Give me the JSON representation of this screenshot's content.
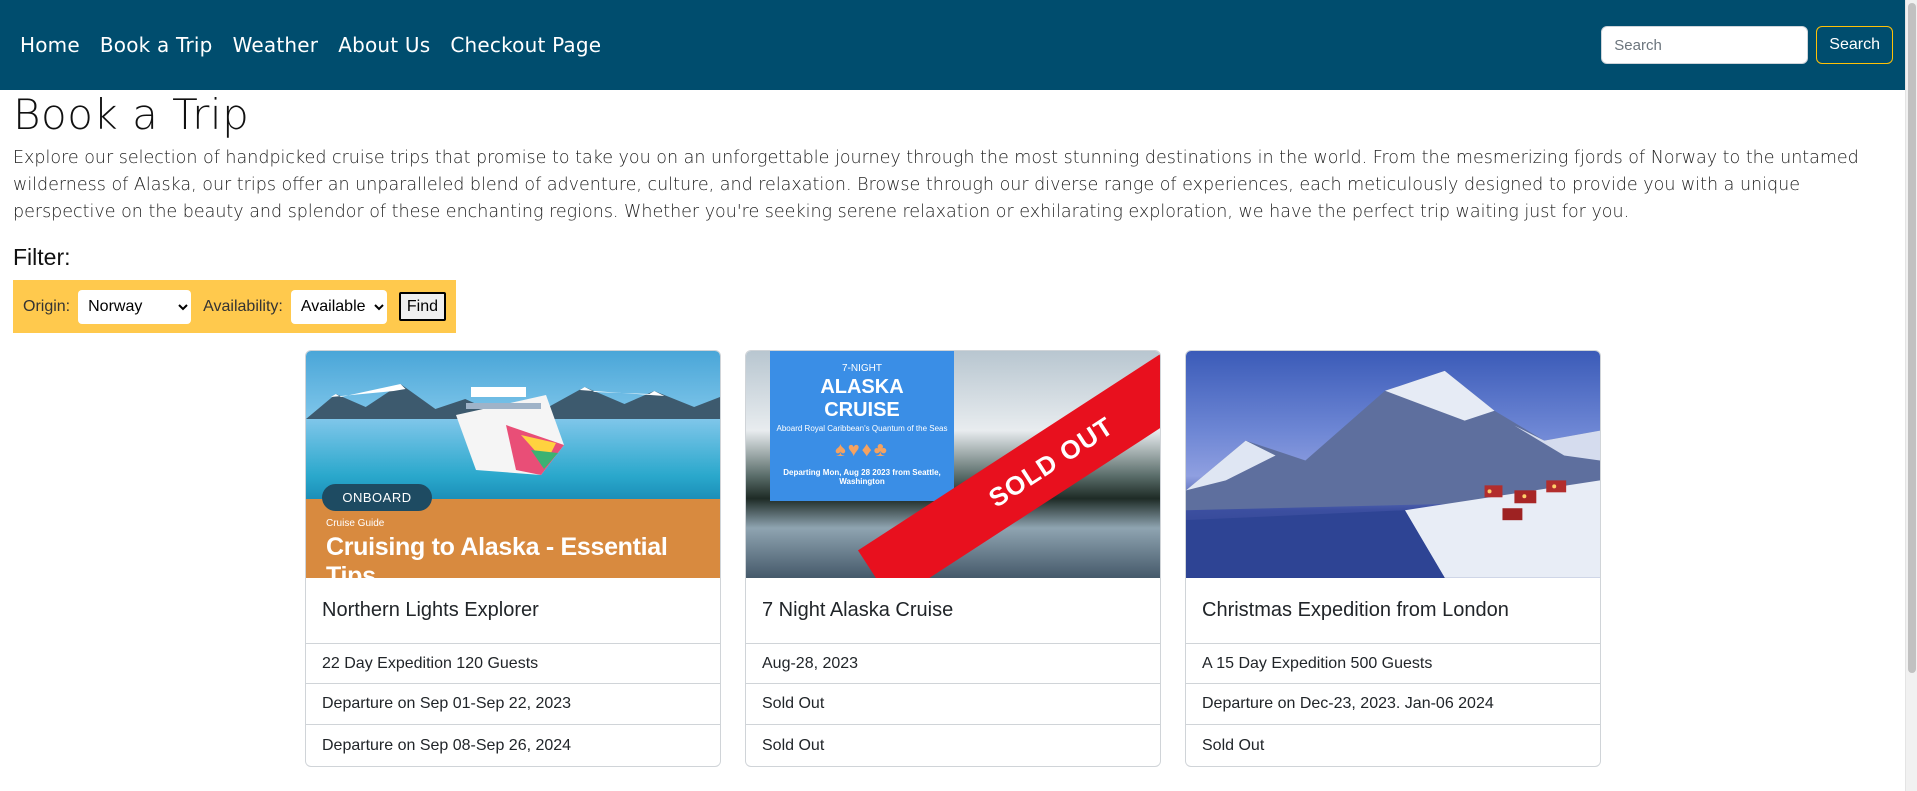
{
  "nav": {
    "links": [
      "Home",
      "Book a Trip",
      "Weather",
      "About Us",
      "Checkout Page"
    ],
    "search_placeholder": "Search",
    "search_button": "Search"
  },
  "page": {
    "title": "Book a Trip",
    "intro": "Explore our selection of handpicked cruise trips that promise to take you on an unforgettable journey through the most stunning destinations in the world. From the mesmerizing fjords of Norway to the untamed wilderness of Alaska, our trips offer an unparalleled blend of adventure, culture, and relaxation. Browse through our diverse range of experiences, each meticulously designed to provide you with a unique perspective on the beauty and splendor of these enchanting regions. Whether you're seeking serene relaxation or exhilarating exploration, we have the perfect trip waiting just for you."
  },
  "filter": {
    "heading": "Filter:",
    "origin_label": "Origin:",
    "origin_value": "Norway",
    "availability_label": "Availability:",
    "availability_value": "Available",
    "find_button": "Find"
  },
  "cards": [
    {
      "title": "Northern Lights Explorer",
      "rows": [
        "22 Day Expedition 120 Guests",
        "Departure on Sep 01-Sep 22, 2023",
        "Departure on Sep 08-Sep 26, 2024"
      ],
      "image": {
        "badge": "ONBOARD",
        "guide": "Cruise Guide",
        "headline": "Cruising to Alaska - Essential Tips"
      }
    },
    {
      "title": "7 Night Alaska Cruise",
      "rows": [
        "Aug-28, 2023",
        "Sold Out",
        "Sold Out"
      ],
      "image": {
        "line1": "7-NIGHT",
        "line2": "ALASKA",
        "line3": "CRUISE",
        "line4": "Aboard Royal Caribbean's Quantum of the Seas",
        "line5": "Departing Mon, Aug 28 2023 from Seattle, Washington",
        "ribbon": "SOLD OUT"
      }
    },
    {
      "title": "Christmas Expedition from London",
      "rows": [
        "A 15 Day Expedition 500 Guests",
        "Departure on Dec-23, 2023. Jan-06 2024",
        "Sold Out"
      ]
    }
  ],
  "colors": {
    "navbar": "#004d6e",
    "filter_bar": "#ffc94d",
    "search_border": "#ffc107",
    "sold_out_ribbon": "#e8101e"
  }
}
